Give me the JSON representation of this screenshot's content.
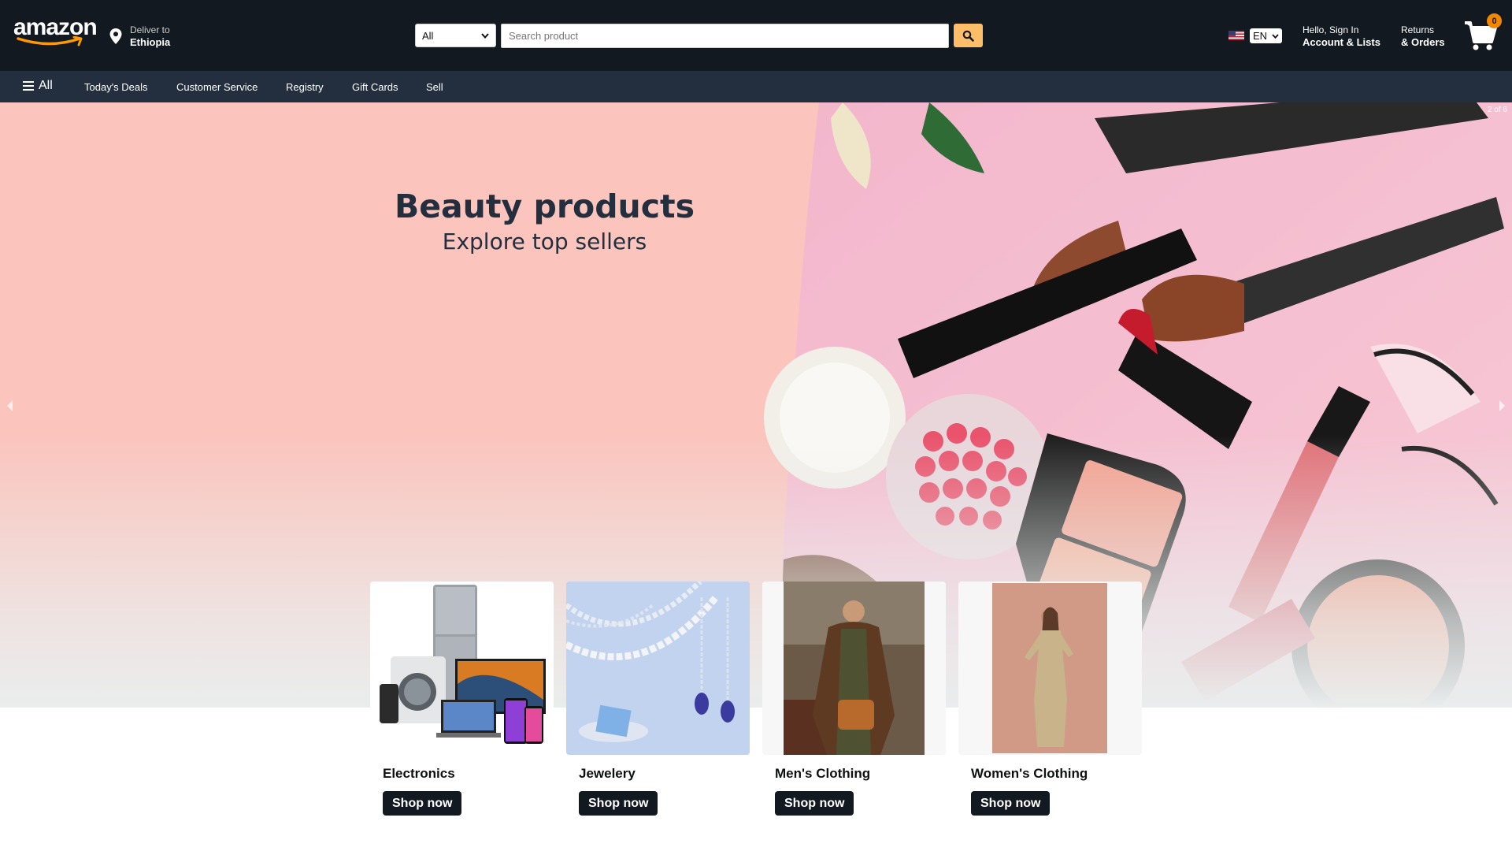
{
  "header": {
    "logo_text": "amazon",
    "deliver_label": "Deliver to",
    "deliver_location": "Ethiopia",
    "search_category": "All",
    "search_placeholder": "Search product",
    "language": "EN",
    "account_greeting": "Hello, Sign In",
    "account_label": "Account & Lists",
    "returns_label": "Returns",
    "orders_label": "& Orders",
    "cart_count": "0"
  },
  "nav": {
    "all_label": "All",
    "items": [
      "Today's Deals",
      "Customer Service",
      "Registry",
      "Gift Cards",
      "Sell"
    ]
  },
  "hero": {
    "title": "Beauty products",
    "subtitle": "Explore top sellers",
    "slide_indicator": "2 of 6"
  },
  "categories": [
    {
      "title": "Electronics",
      "button": "Shop now"
    },
    {
      "title": "Jewelery",
      "button": "Shop now"
    },
    {
      "title": "Men's Clothing",
      "button": "Shop now"
    },
    {
      "title": "Women's Clothing",
      "button": "Shop now"
    }
  ],
  "colors": {
    "header_bg": "#131921",
    "nav_bg": "#232f3e",
    "search_button": "#febd69",
    "cart_badge": "#f08804",
    "hero_bg": "#fbc4bd"
  },
  "icons": [
    "location-pin-icon",
    "search-icon",
    "us-flag-icon",
    "cart-icon",
    "hamburger-icon",
    "chevron-left-icon",
    "chevron-right-icon"
  ]
}
